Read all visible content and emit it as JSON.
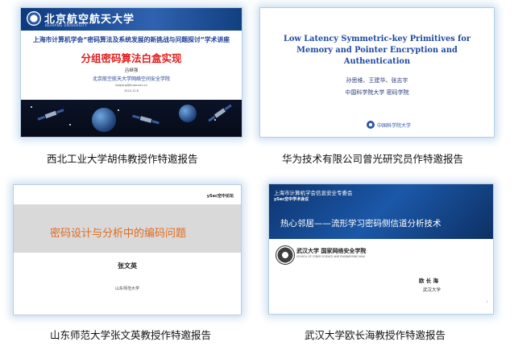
{
  "slides": [
    {
      "university": "北京航空航天大学",
      "university_en": "BEIHANG UNIVERSITY",
      "event": "上海市计算机学会“密码算法及系统发展的新挑战与问题探讨”学术讲座",
      "title": "分组密码算法白盒实现",
      "speaker": "吕继强",
      "affiliation": "北京航空航天大学网络空间安全学院",
      "email": "lvjiqiang@buaa.edu.cn",
      "date": "2024.12.6",
      "caption": "西北工业大学胡伟教授作特邀报告"
    },
    {
      "title": "Low Latency Symmetric-key Primitives for Memory and Pointer Encryption and Authentication",
      "authors": "孙思维、王建华、张志宇",
      "institution": "中国科学院大学 密码学院",
      "logo_text": "中国科学院大学",
      "caption": "华为技术有限公司曾光研究员作特邀报告"
    },
    {
      "tag": "ySec空中论坛",
      "title": "密码设计与分析中的编码问题",
      "speaker": "张文英",
      "affiliation": "山东师范大学",
      "caption": "山东师范大学张文英教授作特邀报告"
    },
    {
      "org": "上海市计算机学会信息安全专委会",
      "conference": "ySec空中学术会议",
      "title": "热心邻居——流形学习密码侧信道分析技术",
      "school": "武汉大学 国家网络安全学院",
      "school_en": "SCHOOL OF CYBER SCIENCE AND ENGINEERING WHU",
      "speaker": "欧 长 海",
      "affiliation": "武汉大学",
      "page": "1",
      "caption": "武汉大学欧长海教授作特邀报告"
    }
  ]
}
